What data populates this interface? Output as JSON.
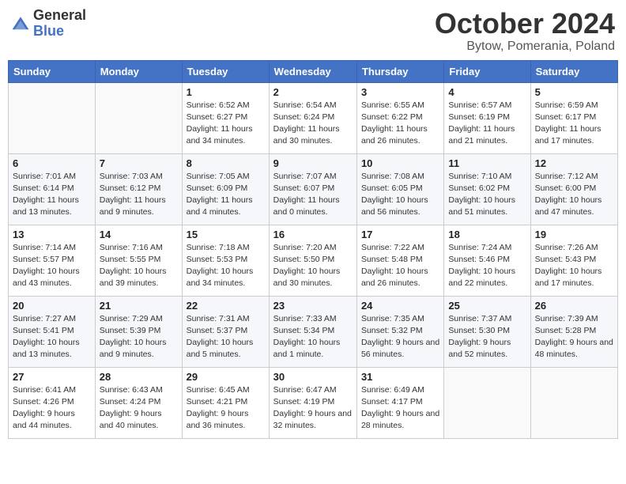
{
  "logo": {
    "general": "General",
    "blue": "Blue"
  },
  "title": "October 2024",
  "location": "Bytow, Pomerania, Poland",
  "weekdays": [
    "Sunday",
    "Monday",
    "Tuesday",
    "Wednesday",
    "Thursday",
    "Friday",
    "Saturday"
  ],
  "weeks": [
    [
      {
        "day": "",
        "info": ""
      },
      {
        "day": "",
        "info": ""
      },
      {
        "day": "1",
        "info": "Sunrise: 6:52 AM\nSunset: 6:27 PM\nDaylight: 11 hours and 34 minutes."
      },
      {
        "day": "2",
        "info": "Sunrise: 6:54 AM\nSunset: 6:24 PM\nDaylight: 11 hours and 30 minutes."
      },
      {
        "day": "3",
        "info": "Sunrise: 6:55 AM\nSunset: 6:22 PM\nDaylight: 11 hours and 26 minutes."
      },
      {
        "day": "4",
        "info": "Sunrise: 6:57 AM\nSunset: 6:19 PM\nDaylight: 11 hours and 21 minutes."
      },
      {
        "day": "5",
        "info": "Sunrise: 6:59 AM\nSunset: 6:17 PM\nDaylight: 11 hours and 17 minutes."
      }
    ],
    [
      {
        "day": "6",
        "info": "Sunrise: 7:01 AM\nSunset: 6:14 PM\nDaylight: 11 hours and 13 minutes."
      },
      {
        "day": "7",
        "info": "Sunrise: 7:03 AM\nSunset: 6:12 PM\nDaylight: 11 hours and 9 minutes."
      },
      {
        "day": "8",
        "info": "Sunrise: 7:05 AM\nSunset: 6:09 PM\nDaylight: 11 hours and 4 minutes."
      },
      {
        "day": "9",
        "info": "Sunrise: 7:07 AM\nSunset: 6:07 PM\nDaylight: 11 hours and 0 minutes."
      },
      {
        "day": "10",
        "info": "Sunrise: 7:08 AM\nSunset: 6:05 PM\nDaylight: 10 hours and 56 minutes."
      },
      {
        "day": "11",
        "info": "Sunrise: 7:10 AM\nSunset: 6:02 PM\nDaylight: 10 hours and 51 minutes."
      },
      {
        "day": "12",
        "info": "Sunrise: 7:12 AM\nSunset: 6:00 PM\nDaylight: 10 hours and 47 minutes."
      }
    ],
    [
      {
        "day": "13",
        "info": "Sunrise: 7:14 AM\nSunset: 5:57 PM\nDaylight: 10 hours and 43 minutes."
      },
      {
        "day": "14",
        "info": "Sunrise: 7:16 AM\nSunset: 5:55 PM\nDaylight: 10 hours and 39 minutes."
      },
      {
        "day": "15",
        "info": "Sunrise: 7:18 AM\nSunset: 5:53 PM\nDaylight: 10 hours and 34 minutes."
      },
      {
        "day": "16",
        "info": "Sunrise: 7:20 AM\nSunset: 5:50 PM\nDaylight: 10 hours and 30 minutes."
      },
      {
        "day": "17",
        "info": "Sunrise: 7:22 AM\nSunset: 5:48 PM\nDaylight: 10 hours and 26 minutes."
      },
      {
        "day": "18",
        "info": "Sunrise: 7:24 AM\nSunset: 5:46 PM\nDaylight: 10 hours and 22 minutes."
      },
      {
        "day": "19",
        "info": "Sunrise: 7:26 AM\nSunset: 5:43 PM\nDaylight: 10 hours and 17 minutes."
      }
    ],
    [
      {
        "day": "20",
        "info": "Sunrise: 7:27 AM\nSunset: 5:41 PM\nDaylight: 10 hours and 13 minutes."
      },
      {
        "day": "21",
        "info": "Sunrise: 7:29 AM\nSunset: 5:39 PM\nDaylight: 10 hours and 9 minutes."
      },
      {
        "day": "22",
        "info": "Sunrise: 7:31 AM\nSunset: 5:37 PM\nDaylight: 10 hours and 5 minutes."
      },
      {
        "day": "23",
        "info": "Sunrise: 7:33 AM\nSunset: 5:34 PM\nDaylight: 10 hours and 1 minute."
      },
      {
        "day": "24",
        "info": "Sunrise: 7:35 AM\nSunset: 5:32 PM\nDaylight: 9 hours and 56 minutes."
      },
      {
        "day": "25",
        "info": "Sunrise: 7:37 AM\nSunset: 5:30 PM\nDaylight: 9 hours and 52 minutes."
      },
      {
        "day": "26",
        "info": "Sunrise: 7:39 AM\nSunset: 5:28 PM\nDaylight: 9 hours and 48 minutes."
      }
    ],
    [
      {
        "day": "27",
        "info": "Sunrise: 6:41 AM\nSunset: 4:26 PM\nDaylight: 9 hours and 44 minutes."
      },
      {
        "day": "28",
        "info": "Sunrise: 6:43 AM\nSunset: 4:24 PM\nDaylight: 9 hours and 40 minutes."
      },
      {
        "day": "29",
        "info": "Sunrise: 6:45 AM\nSunset: 4:21 PM\nDaylight: 9 hours and 36 minutes."
      },
      {
        "day": "30",
        "info": "Sunrise: 6:47 AM\nSunset: 4:19 PM\nDaylight: 9 hours and 32 minutes."
      },
      {
        "day": "31",
        "info": "Sunrise: 6:49 AM\nSunset: 4:17 PM\nDaylight: 9 hours and 28 minutes."
      },
      {
        "day": "",
        "info": ""
      },
      {
        "day": "",
        "info": ""
      }
    ]
  ]
}
